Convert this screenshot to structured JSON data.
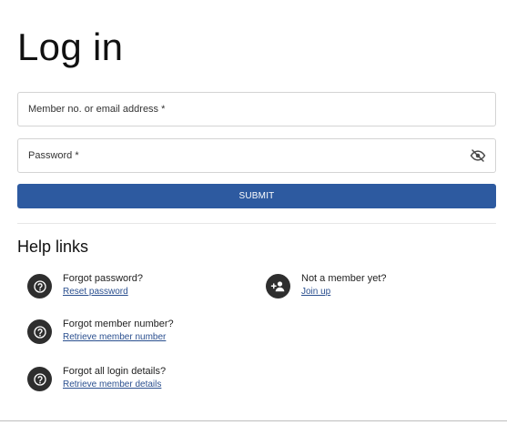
{
  "page": {
    "title": "Log in"
  },
  "form": {
    "email_label": "Member no. or email address *",
    "password_label": "Password *",
    "submit_label": "SUBMIT",
    "accent_color": "#2d5aa0"
  },
  "help": {
    "title": "Help links",
    "items": [
      {
        "question": "Forgot password?",
        "link": "Reset password",
        "icon": "question-circle-icon"
      },
      {
        "question": "Forgot member number?",
        "link": "Retrieve member number",
        "icon": "question-circle-icon"
      },
      {
        "question": "Forgot all login details?",
        "link": "Retrieve member details",
        "icon": "question-circle-icon"
      },
      {
        "question": "Not a member yet?",
        "link": "Join up",
        "icon": "add-user-icon"
      }
    ]
  }
}
